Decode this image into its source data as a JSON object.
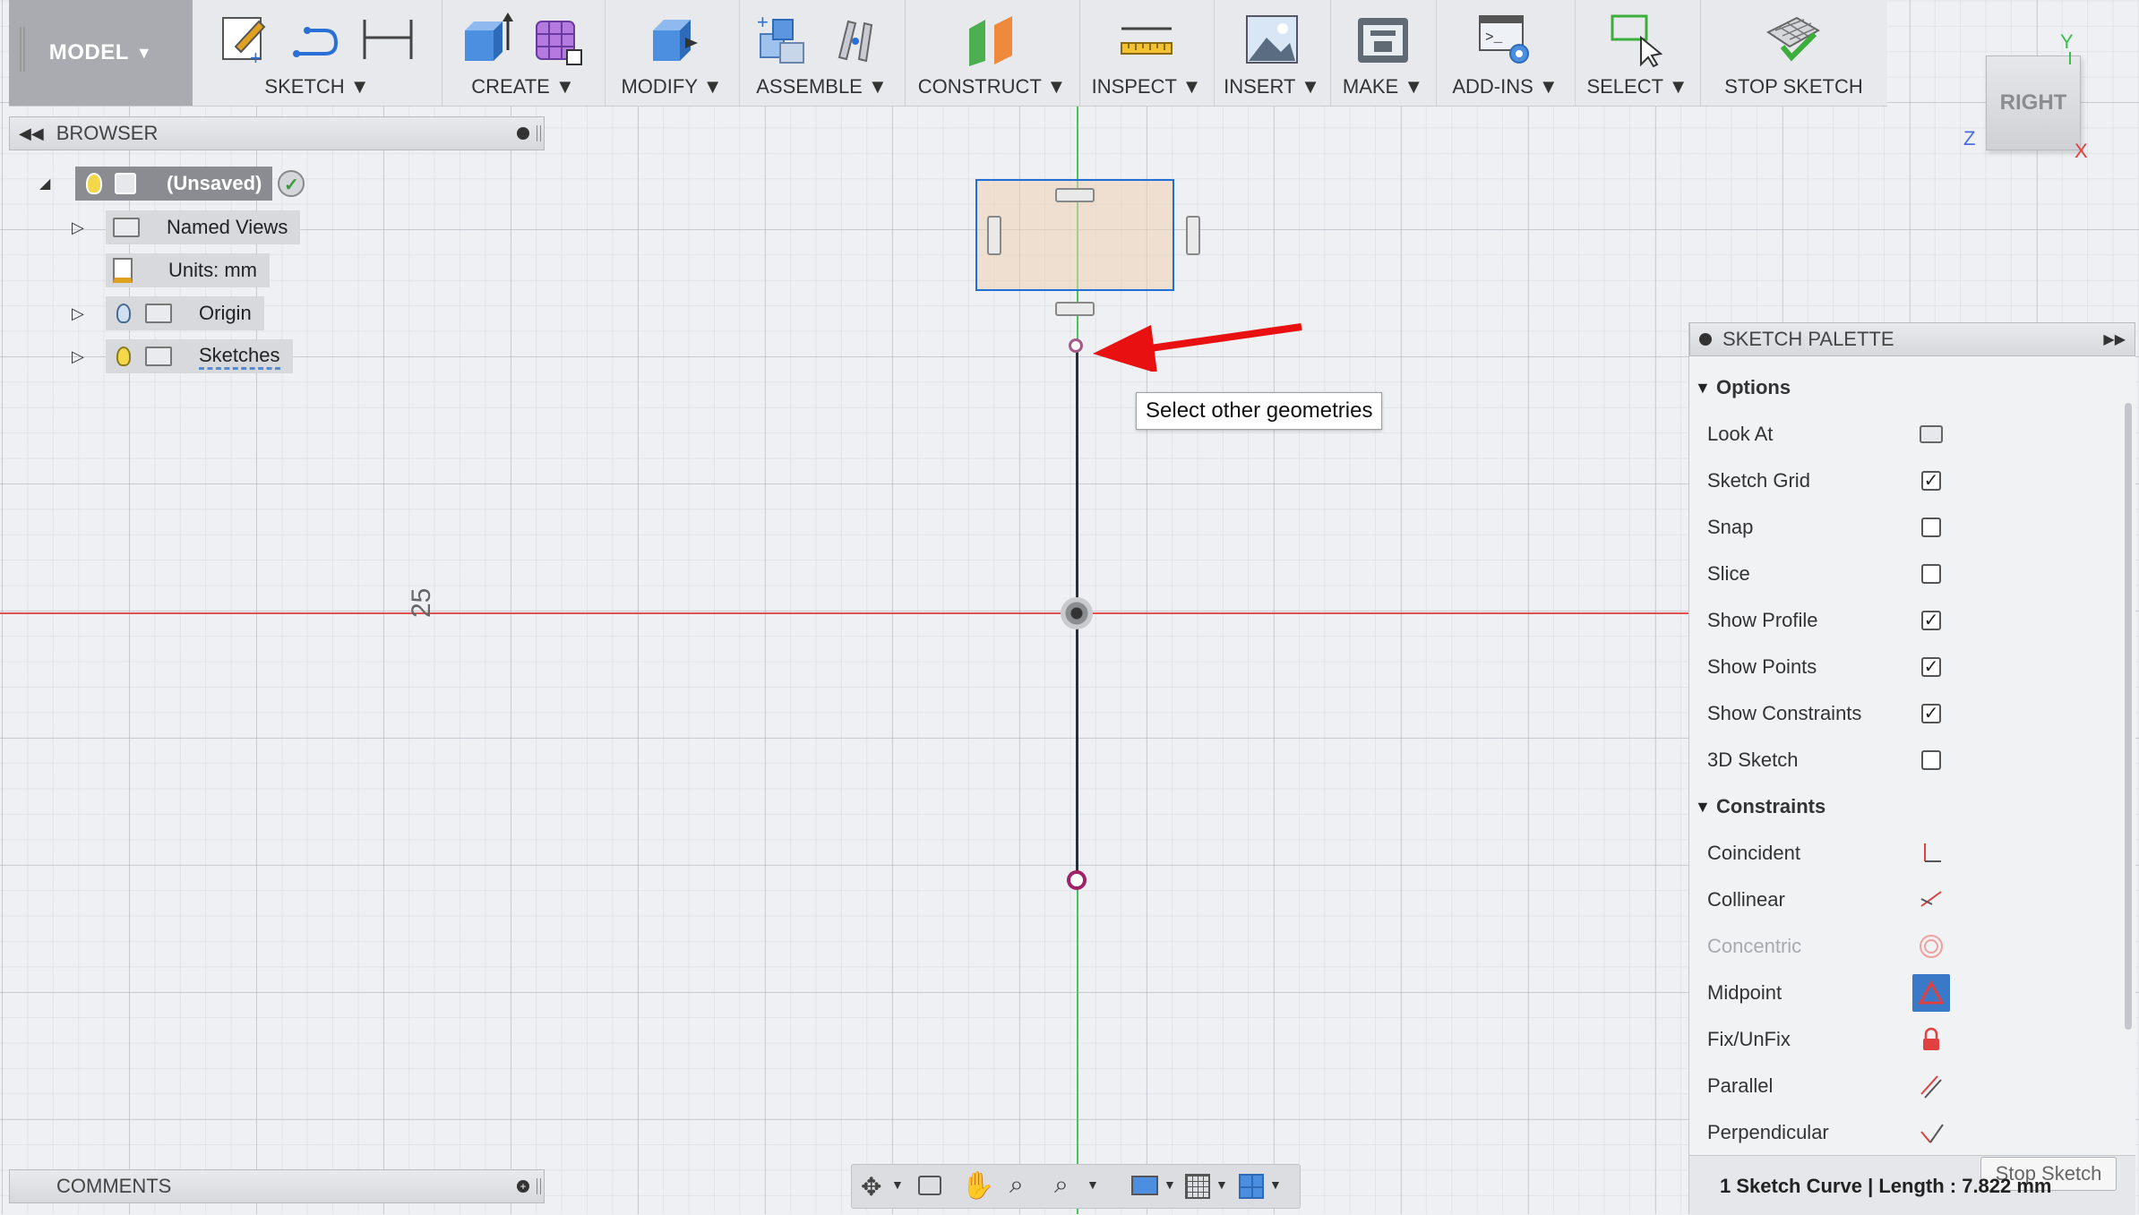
{
  "toolbar": {
    "model_label": "MODEL",
    "groups": [
      {
        "label": "SKETCH"
      },
      {
        "label": "CREATE"
      },
      {
        "label": "MODIFY"
      },
      {
        "label": "ASSEMBLE"
      },
      {
        "label": "CONSTRUCT"
      },
      {
        "label": "INSPECT"
      },
      {
        "label": "INSERT"
      },
      {
        "label": "MAKE"
      },
      {
        "label": "ADD-INS"
      },
      {
        "label": "SELECT"
      },
      {
        "label": "STOP SKETCH"
      }
    ]
  },
  "browser": {
    "title": "BROWSER",
    "root": "(Unsaved)",
    "items": [
      {
        "label": "Named Views"
      },
      {
        "label": "Units: mm"
      },
      {
        "label": "Origin"
      },
      {
        "label": "Sketches"
      }
    ]
  },
  "comments": {
    "title": "COMMENTS"
  },
  "viewcube": {
    "face": "RIGHT",
    "axis_y": "Y",
    "axis_z": "Z",
    "axis_x": "X"
  },
  "canvas": {
    "tooltip": "Select other geometries",
    "dimension_text": "25"
  },
  "palette": {
    "title": "SKETCH PALETTE",
    "options_header": "Options",
    "options": [
      {
        "label": "Look At",
        "type": "icon",
        "icon": "look-at-icon"
      },
      {
        "label": "Sketch Grid",
        "type": "checkbox",
        "checked": true
      },
      {
        "label": "Snap",
        "type": "checkbox",
        "checked": false
      },
      {
        "label": "Slice",
        "type": "checkbox",
        "checked": false
      },
      {
        "label": "Show Profile",
        "type": "checkbox",
        "checked": true
      },
      {
        "label": "Show Points",
        "type": "checkbox",
        "checked": true
      },
      {
        "label": "Show Constraints",
        "type": "checkbox",
        "checked": true
      },
      {
        "label": "3D Sketch",
        "type": "checkbox",
        "checked": false
      }
    ],
    "constraints_header": "Constraints",
    "constraints": [
      {
        "label": "Coincident",
        "icon": "coincident-icon"
      },
      {
        "label": "Collinear",
        "icon": "collinear-icon"
      },
      {
        "label": "Concentric",
        "icon": "concentric-icon",
        "disabled": true
      },
      {
        "label": "Midpoint",
        "icon": "midpoint-icon",
        "active": true
      },
      {
        "label": "Fix/UnFix",
        "icon": "lock-icon"
      },
      {
        "label": "Parallel",
        "icon": "parallel-icon"
      },
      {
        "label": "Perpendicular",
        "icon": "perpendicular-icon"
      }
    ],
    "stop_sketch": "Stop Sketch"
  },
  "status": {
    "text": "1 Sketch Curve | Length : 7.822 mm"
  },
  "colors": {
    "accent": "#1f6fd6",
    "axis_red": "#e04040",
    "axis_green": "#35c24a",
    "point": "#a0206a",
    "arrow": "#e81010"
  }
}
